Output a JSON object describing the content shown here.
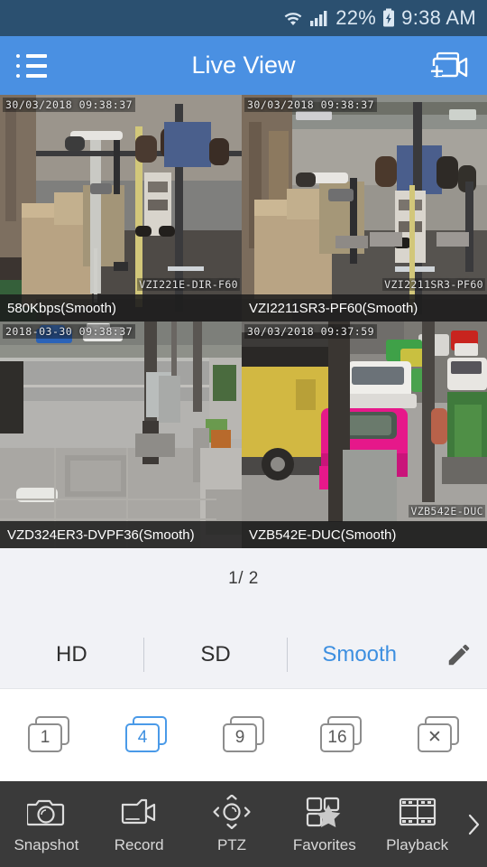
{
  "statusbar": {
    "battery_percent": "22%",
    "time": "9:38 AM",
    "wifi_icon": "wifi-icon",
    "signal_icon": "signal-bars-icon",
    "battery_icon": "battery-charging-icon"
  },
  "header": {
    "title": "Live View",
    "menu_icon": "list-menu-icon",
    "add_camera_icon": "add-camera-icon"
  },
  "grid": {
    "tiles": [
      {
        "timestamp": "30/03/2018 09:38:37",
        "camera_id": "VZI221E-DIR-F60",
        "label": "580Kbps(Smooth)",
        "selected": true,
        "scene": "store-interior-boxes"
      },
      {
        "timestamp": "30/03/2018 09:38:37",
        "camera_id": "VZI2211SR3-PF60",
        "label": "VZI2211SR3-PF60(Smooth)",
        "selected": false,
        "scene": "store-entrance-window"
      },
      {
        "timestamp": "2018-03-30 09:38:37",
        "camera_id": "",
        "label": "VZD324ER3-DVPF36(Smooth)",
        "selected": false,
        "scene": "street-sidewalk"
      },
      {
        "timestamp": "30/03/2018 09:37:59",
        "camera_id": "VZB542E-DUC",
        "label": "VZB542E-DUC(Smooth)",
        "selected": false,
        "scene": "street-traffic-bus"
      }
    ]
  },
  "page_indicator": "1/ 2",
  "quality": {
    "options": [
      {
        "label": "HD",
        "active": false
      },
      {
        "label": "SD",
        "active": false
      },
      {
        "label": "Smooth",
        "active": true
      }
    ],
    "edit_icon": "pencil-edit-icon",
    "active_color": "#3d8fe0"
  },
  "layouts": [
    {
      "label": "1",
      "active": false
    },
    {
      "label": "4",
      "active": true
    },
    {
      "label": "9",
      "active": false
    },
    {
      "label": "16",
      "active": false
    },
    {
      "label": "✕",
      "active": false,
      "name": "close-all-layout"
    }
  ],
  "toolbar": {
    "items": [
      {
        "label": "Snapshot",
        "icon": "camera-icon"
      },
      {
        "label": "Record",
        "icon": "video-camera-icon"
      },
      {
        "label": "PTZ",
        "icon": "ptz-directional-icon"
      },
      {
        "label": "Favorites",
        "icon": "favorites-star-icon"
      },
      {
        "label": "Playback",
        "icon": "film-strip-icon"
      }
    ],
    "more_icon": "chevron-right-icon"
  },
  "colors": {
    "status_bar": "#2b5070",
    "header": "#4a90e2",
    "accent": "#3d8fe0",
    "selection": "#c8a63c",
    "toolbar": "#3a3a3a"
  }
}
